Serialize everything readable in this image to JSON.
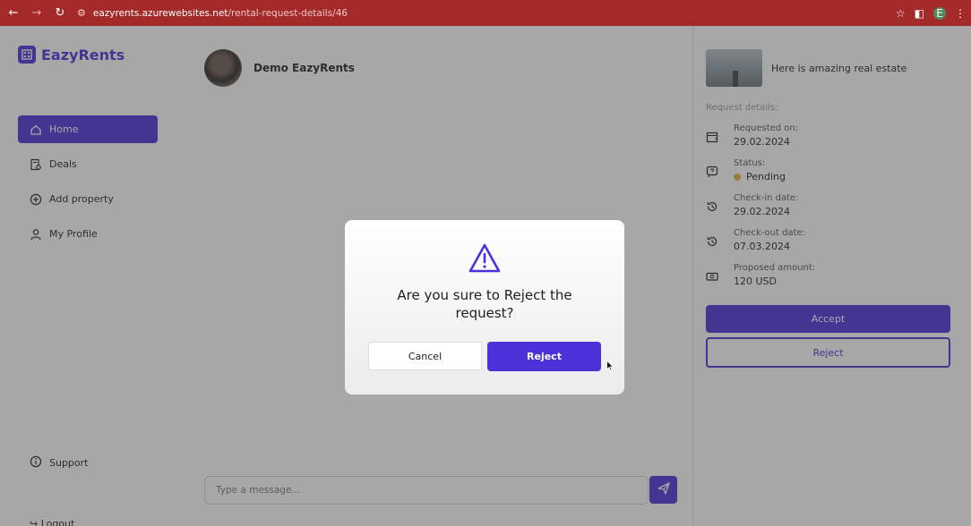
{
  "browser": {
    "host": "eazyrents.azurewebsites.net",
    "path": "/rental-request-details/46",
    "profile_initial": "E"
  },
  "app": {
    "brand": "EazyRents",
    "accent": "#4a32d9",
    "sidebar": {
      "items": [
        {
          "label": "Home",
          "icon": "home-icon",
          "active": true
        },
        {
          "label": "Deals",
          "icon": "deals-icon",
          "active": false
        },
        {
          "label": "Add property",
          "icon": "add-circle-icon",
          "active": false
        },
        {
          "label": "My Profile",
          "icon": "user-icon",
          "active": false
        }
      ],
      "support_label": "Support",
      "logout_label": "Logout"
    },
    "chat": {
      "contact_name": "Demo EazyRents",
      "message_placeholder": "Type a message..."
    },
    "details": {
      "property_title": "Here is amazing real estate",
      "section_label": "Request details:",
      "requested_on_label": "Requested on:",
      "requested_on_value": "29.02.2024",
      "status_label": "Status:",
      "status_value": "Pending",
      "status_color": "#e3b341",
      "checkin_label": "Check-in date:",
      "checkin_value": "29.02.2024",
      "checkout_label": "Check-out date:",
      "checkout_value": "07.03.2024",
      "amount_label": "Proposed amount:",
      "amount_value": "120 USD",
      "accept_label": "Accept",
      "reject_label": "Reject"
    }
  },
  "modal": {
    "question_line1": "Are you sure to Reject the",
    "question_line2": "request?",
    "cancel_label": "Cancel",
    "reject_label": "Reject"
  }
}
